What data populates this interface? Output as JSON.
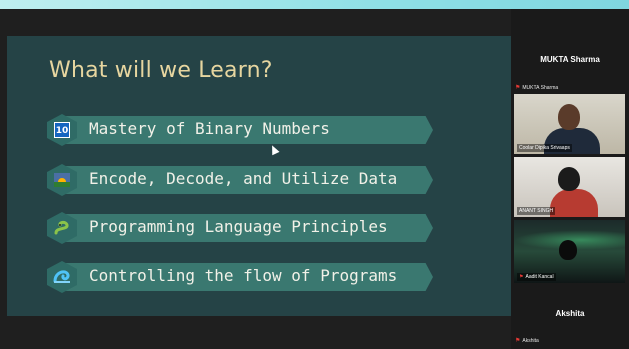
{
  "slide": {
    "title": "What will we Learn?",
    "items": [
      {
        "badge": "10",
        "label": "Mastery of Binary Numbers"
      },
      {
        "badge": "",
        "label": "Encode, Decode, and Utilize Data"
      },
      {
        "badge": "",
        "label": "Programming Language Principles"
      },
      {
        "badge": "",
        "label": "Controlling the flow of Programs"
      }
    ]
  },
  "sidebar": {
    "host_name": "MUKTA Sharma",
    "host_label": "MUKTA Sharma",
    "videos": [
      {
        "name": "Coolar Dipika Srivaaps"
      },
      {
        "name": "ANANT SINGH"
      },
      {
        "name": "Aadit Kancal"
      }
    ],
    "bottom_name": "Akshita",
    "bottom_label": "Akshita"
  }
}
